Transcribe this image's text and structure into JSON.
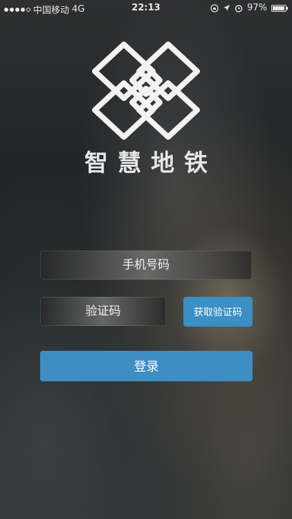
{
  "status_bar": {
    "carrier": "中国移动",
    "network": "4G",
    "time": "22:13",
    "battery_percent": "97%",
    "battery_level": 0.97
  },
  "app": {
    "title": "智慧地铁"
  },
  "form": {
    "phone_placeholder": "手机号码",
    "code_placeholder": "验证码",
    "get_code_label": "获取验证码",
    "login_label": "登录"
  },
  "colors": {
    "button_blue": "#3a8fc4"
  },
  "icons": {
    "logo": "interlocking-diamonds-logo",
    "lock": "rotation-lock-icon",
    "location": "location-arrow-icon",
    "alarm": "alarm-clock-icon",
    "battery": "battery-icon"
  }
}
